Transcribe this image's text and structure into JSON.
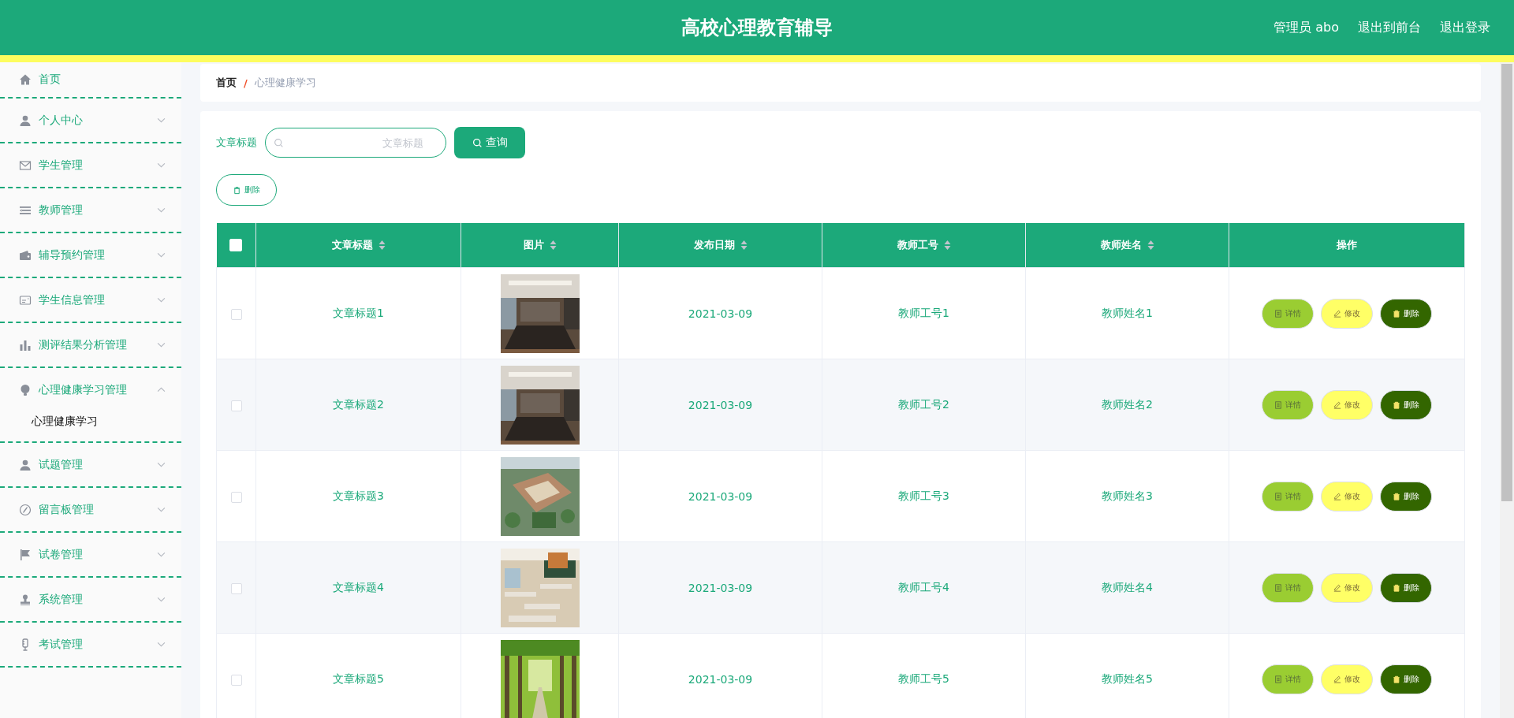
{
  "header": {
    "title": "高校心理教育辅导",
    "user": "管理员 abo",
    "links": [
      "退出到前台",
      "退出登录"
    ]
  },
  "sidebar": {
    "items": [
      {
        "label": "首页",
        "kind": "link"
      },
      {
        "label": "个人中心",
        "kind": "menu",
        "expanded": false
      },
      {
        "label": "学生管理",
        "kind": "menu",
        "expanded": false
      },
      {
        "label": "教师管理",
        "kind": "menu",
        "expanded": false
      },
      {
        "label": "辅导预约管理",
        "kind": "menu",
        "expanded": false
      },
      {
        "label": "学生信息管理",
        "kind": "menu",
        "expanded": false
      },
      {
        "label": "测评结果分析管理",
        "kind": "menu",
        "expanded": false
      },
      {
        "label": "心理健康学习管理",
        "kind": "menu",
        "expanded": true,
        "children": [
          {
            "label": "心理健康学习",
            "selected": true
          }
        ]
      },
      {
        "label": "试题管理",
        "kind": "menu",
        "expanded": false
      },
      {
        "label": "留言板管理",
        "kind": "menu",
        "expanded": false
      },
      {
        "label": "试卷管理",
        "kind": "menu",
        "expanded": false
      },
      {
        "label": "系统管理",
        "kind": "menu",
        "expanded": false
      },
      {
        "label": "考试管理",
        "kind": "menu",
        "expanded": false
      }
    ]
  },
  "breadcrumb": {
    "home": "首页",
    "separator": "/",
    "current": "心理健康学习"
  },
  "search": {
    "label": "文章标题",
    "placeholder": "文章标题",
    "button": "查询"
  },
  "delete_button": "删除",
  "table": {
    "select_all": false,
    "columns": [
      {
        "label": "文章标题",
        "sortable": true
      },
      {
        "label": "图片",
        "sortable": true
      },
      {
        "label": "发布日期",
        "sortable": true
      },
      {
        "label": "教师工号",
        "sortable": true
      },
      {
        "label": "教师姓名",
        "sortable": true
      },
      {
        "label": "操作",
        "sortable": false
      }
    ],
    "rows": [
      {
        "selected": false,
        "title": "文章标题1",
        "date": "2021-03-09",
        "teacher_id": "教师工号1",
        "teacher_name": "教师姓名1",
        "actions": [
          "详情",
          "修改",
          "删除"
        ]
      },
      {
        "selected": false,
        "title": "文章标题2",
        "date": "2021-03-09",
        "teacher_id": "教师工号2",
        "teacher_name": "教师姓名2",
        "actions": [
          "详情",
          "修改",
          "删除"
        ]
      },
      {
        "selected": false,
        "title": "文章标题3",
        "date": "2021-03-09",
        "teacher_id": "教师工号3",
        "teacher_name": "教师姓名3",
        "actions": [
          "详情",
          "修改",
          "删除"
        ]
      },
      {
        "selected": false,
        "title": "文章标题4",
        "date": "2021-03-09",
        "teacher_id": "教师工号4",
        "teacher_name": "教师姓名4",
        "actions": [
          "详情",
          "修改",
          "删除"
        ]
      },
      {
        "selected": false,
        "title": "文章标题5",
        "date": "2021-03-09",
        "teacher_id": "教师工号5",
        "teacher_name": "教师姓名5",
        "actions": [
          "详情",
          "修改",
          "删除"
        ]
      }
    ]
  }
}
